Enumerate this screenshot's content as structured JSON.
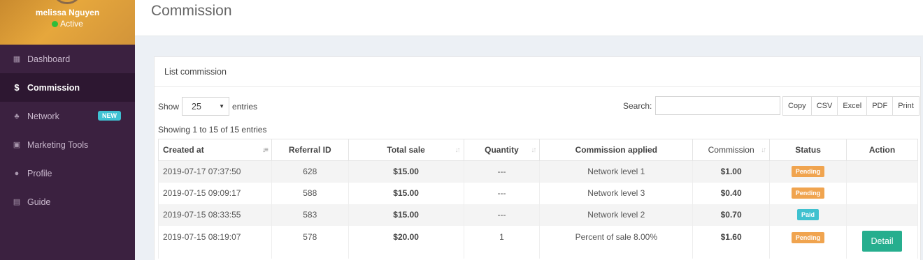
{
  "user": {
    "name": "melissa Nguyen",
    "status": "Active"
  },
  "sidebar": {
    "items": [
      {
        "label": "Dashboard",
        "icon": "dashboard-icon",
        "glyph": "▦"
      },
      {
        "label": "Commission",
        "icon": "dollar-icon",
        "glyph": "$"
      },
      {
        "label": "Network",
        "icon": "sitemap-icon",
        "glyph": "♣",
        "badge": "NEW"
      },
      {
        "label": "Marketing Tools",
        "icon": "image-icon",
        "glyph": "▣"
      },
      {
        "label": "Profile",
        "icon": "user-circle-icon",
        "glyph": "●"
      },
      {
        "label": "Guide",
        "icon": "book-icon",
        "glyph": "▤"
      }
    ]
  },
  "header": {
    "title": "Commission"
  },
  "box": {
    "title": "List commission",
    "show_label": "Show",
    "entries_label": "entries",
    "page_size": "25",
    "search_label": "Search:",
    "search_value": "",
    "buttons": {
      "copy": "Copy",
      "csv": "CSV",
      "excel": "Excel",
      "pdf": "PDF",
      "print": "Print"
    },
    "info": "Showing 1 to 15 of 15 entries"
  },
  "table": {
    "headers": {
      "created_at": "Created at",
      "referral_id": "Referral ID",
      "total_sale": "Total sale",
      "quantity": "Quantity",
      "commission_applied": "Commission applied",
      "commission": "Commission",
      "status": "Status",
      "action": "Action"
    },
    "rows": [
      {
        "created_at": "2019-07-17 07:37:50",
        "referral_id": "628",
        "total_sale": "$15.00",
        "quantity": "---",
        "commission_applied": "Network level 1",
        "commission": "$1.00",
        "status": "Pending",
        "action": ""
      },
      {
        "created_at": "2019-07-15 09:09:17",
        "referral_id": "588",
        "total_sale": "$15.00",
        "quantity": "---",
        "commission_applied": "Network level 3",
        "commission": "$0.40",
        "status": "Pending",
        "action": ""
      },
      {
        "created_at": "2019-07-15 08:33:55",
        "referral_id": "583",
        "total_sale": "$15.00",
        "quantity": "---",
        "commission_applied": "Network level 2",
        "commission": "$0.70",
        "status": "Paid",
        "action": ""
      },
      {
        "created_at": "2019-07-15 08:19:07",
        "referral_id": "578",
        "total_sale": "$20.00",
        "quantity": "1",
        "commission_applied": "Percent of sale 8.00%",
        "commission": "$1.60",
        "status": "Pending",
        "action": "Detail"
      }
    ]
  },
  "colors": {
    "sidebar_bg": "#3b2140",
    "pending": "#f0a44f",
    "paid": "#3fc1cf",
    "detail": "#26ae8e",
    "new_badge": "#3fc1d3"
  }
}
